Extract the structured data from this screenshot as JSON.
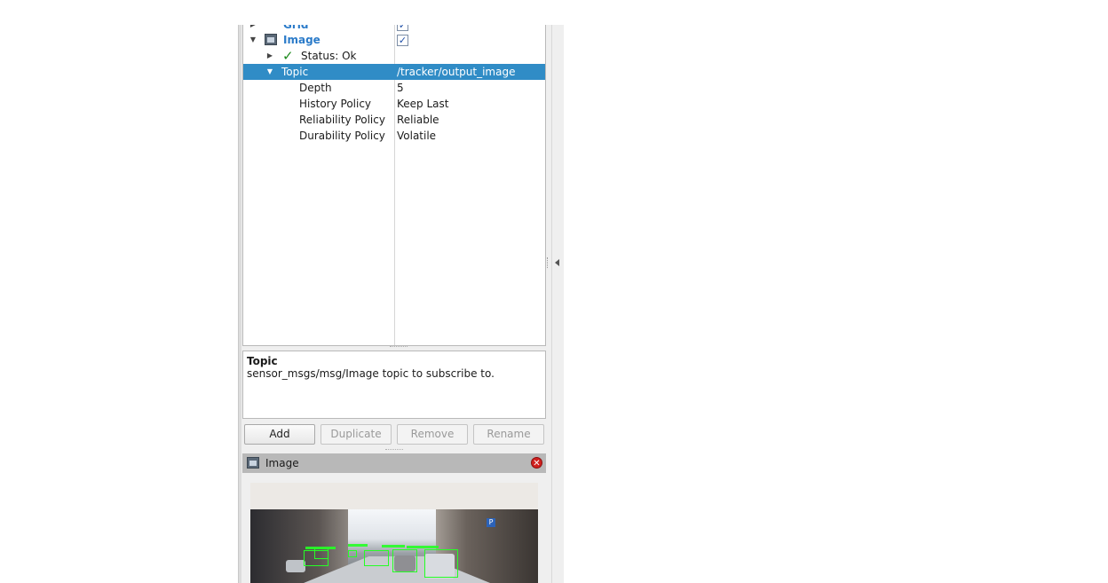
{
  "tree": {
    "rows": [
      {
        "label": "Grid",
        "value": "",
        "checked": true
      },
      {
        "label": "Image",
        "value": "",
        "checked": true
      },
      {
        "label": "Status: Ok",
        "value": ""
      },
      {
        "label": "Topic",
        "value": "/tracker/output_image"
      },
      {
        "label": "Depth",
        "value": "5"
      },
      {
        "label": "History Policy",
        "value": "Keep Last"
      },
      {
        "label": "Reliability Policy",
        "value": "Reliable"
      },
      {
        "label": "Durability Policy",
        "value": "Volatile"
      }
    ],
    "check_glyph": "✓"
  },
  "description": {
    "title": "Topic",
    "text": "sensor_msgs/msg/Image topic to subscribe to."
  },
  "buttons": {
    "add": "Add",
    "duplicate": "Duplicate",
    "remove": "Remove",
    "rename": "Rename"
  },
  "image_panel": {
    "title": "Image",
    "close_glyph": "✕"
  },
  "icons": {
    "expander_collapsed": "▶",
    "expander_expanded": "▼",
    "status_ok": "✓"
  },
  "colors": {
    "selection": "#308cc6",
    "display_name": "#2b7bc9",
    "status_ok": "#1d8a1d",
    "bbox": "#25ff25"
  }
}
